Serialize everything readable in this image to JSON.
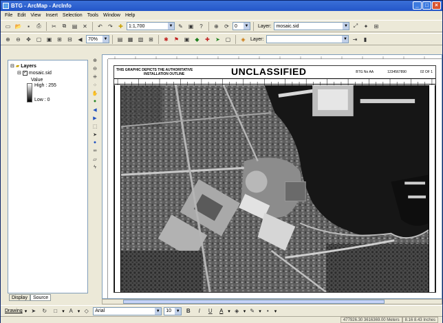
{
  "window": {
    "title": "BTG - ArcMap - ArcInfo"
  },
  "menu": [
    "File",
    "Edit",
    "View",
    "Insert",
    "Selection",
    "Tools",
    "Window",
    "Help"
  ],
  "toolbar1": {
    "scale_value": "1:1,700",
    "layer_label": "Layer:",
    "layer_value": "mosaic.sid",
    "spin_value": "0"
  },
  "toolbar2": {
    "zoom_value": "70%",
    "layer_label": "Layer:",
    "layer_value": ""
  },
  "toc": {
    "root": "Layers",
    "layer": "mosaic.sid",
    "legend_title": "Value",
    "high": "High : 255",
    "low": "Low : 0",
    "tabs": [
      "Display",
      "Source"
    ]
  },
  "layout": {
    "header_left_line1": "THIS GRAPHIC DEPICTS THE AUTHORITATIVE",
    "header_left_line2": "INSTALLATION OUTLINE",
    "header_center": "UNCLASSIFIED",
    "header_right_a": "BTG No AA",
    "header_right_b": "1234567890",
    "header_right_c": "02 OF 1"
  },
  "drawing": {
    "drawing_label": "Drawing",
    "font": "Arial",
    "font_size": "10",
    "bold": "B",
    "italic": "I",
    "underline": "U",
    "text_tool": "A"
  },
  "status": {
    "coordinates": "477926.30  3616369.00 Meters",
    "page_coords": "8.16  8.43 Inches"
  }
}
